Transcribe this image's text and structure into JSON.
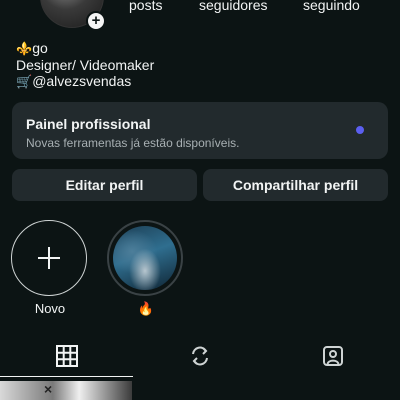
{
  "profile": {
    "stats": {
      "posts_label": "posts",
      "followers_label": "seguidores",
      "following_label": "seguindo"
    },
    "bio": {
      "name_emoji": "⚜️",
      "name": "go",
      "line2": "Designer/ Videomaker",
      "line3_emoji": "🛒",
      "line3": "@alvezsvendas"
    },
    "add_badge": "+"
  },
  "panel": {
    "title": "Painel profissional",
    "subtitle": "Novas ferramentas já estão disponíveis.",
    "dot_color": "#5b5ff0"
  },
  "buttons": {
    "edit": "Editar perfil",
    "share": "Compartilhar perfil"
  },
  "highlights": [
    {
      "label": "Novo",
      "icon": "plus-icon"
    },
    {
      "label": "🔥",
      "icon": "story-thumbnail"
    }
  ],
  "tabs": [
    {
      "icon": "grid-icon",
      "active": true
    },
    {
      "icon": "reels-icon",
      "active": false
    },
    {
      "icon": "tagged-icon",
      "active": false
    }
  ],
  "thumbs": {
    "overlay": "×"
  },
  "colors": {
    "background": "#0c1414",
    "surface": "#222a2d",
    "text": "#f2f4f4",
    "muted": "#a8b0b3"
  }
}
